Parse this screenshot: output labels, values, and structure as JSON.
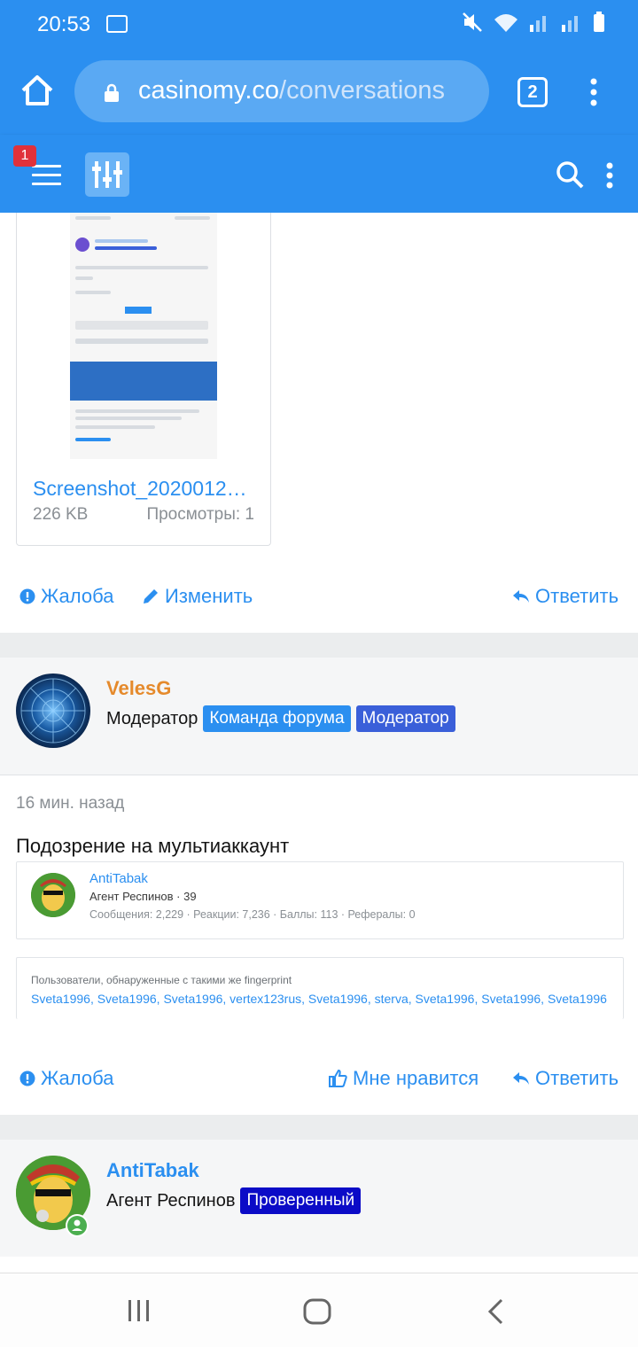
{
  "status_bar": {
    "time": "20:53"
  },
  "browser": {
    "url_host": "casinomy.co",
    "url_path": "/conversations",
    "tab_count": "2"
  },
  "forum_header": {
    "notification_count": "1"
  },
  "attachment": {
    "filename": "Screenshot_2020012…",
    "size": "226 KB",
    "views": "Просмотры: 1"
  },
  "post1_actions": {
    "report": "Жалоба",
    "edit": "Изменить",
    "reply": "Ответить"
  },
  "post2": {
    "username": "VelesG",
    "user_title": "Модератор",
    "banners": [
      "Команда форума",
      "Модератор"
    ],
    "time": "16 мин. назад",
    "text": "Подозрение на мультиаккаунт",
    "quote": {
      "username": "AntiTabak",
      "title": "Агент Респинов · 39",
      "stats": "Сообщения: 2,229 · Реакции: 7,236 · Баллы: 113 · Рефералы: 0"
    },
    "fingerprint": {
      "title": "Пользователи, обнаруженные с такими же fingerprint",
      "users": "Sveta1996, Sveta1996, Sveta1996, vertex123rus, Sveta1996, sterva, Sveta1996, Sveta1996, Sveta1996"
    },
    "actions": {
      "report": "Жалоба",
      "like": "Мне нравится",
      "reply": "Ответить"
    }
  },
  "post3": {
    "username": "AntiTabak",
    "user_title": "Агент Респинов",
    "banner": "Проверенный"
  },
  "colors": {
    "accent": "#2b8ff0",
    "moderator_name": "#e58a2c",
    "banner_team": "#2b8ff0",
    "banner_mod": "#3a5fd9",
    "banner_verified": "#0b0bc7"
  }
}
